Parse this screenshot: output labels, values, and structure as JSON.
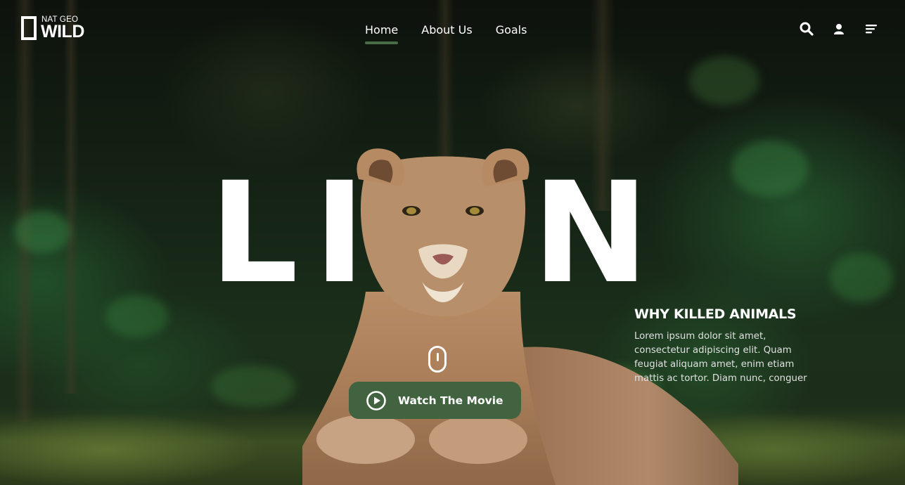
{
  "brand": {
    "top_text": "NAT GEO",
    "big_text": "WILD"
  },
  "nav": {
    "items": [
      {
        "label": "Home",
        "active": true
      },
      {
        "label": "About Us",
        "active": false
      },
      {
        "label": "Goals",
        "active": false
      }
    ]
  },
  "header_icons": [
    "search-icon",
    "user-icon",
    "menu-icon"
  ],
  "hero": {
    "letters": [
      "L",
      "I",
      "N"
    ],
    "heading": "WHY KILLED ANIMALS",
    "description": "Lorem ipsum dolor sit amet, consectetur adipiscing elit. Quam feugiat aliquam amet, enim etiam mattis ac tortor. Diam nunc, conguer",
    "cta_label": "Watch The Movie"
  },
  "colors": {
    "accent": "#42633f",
    "text": "#ffffff"
  }
}
